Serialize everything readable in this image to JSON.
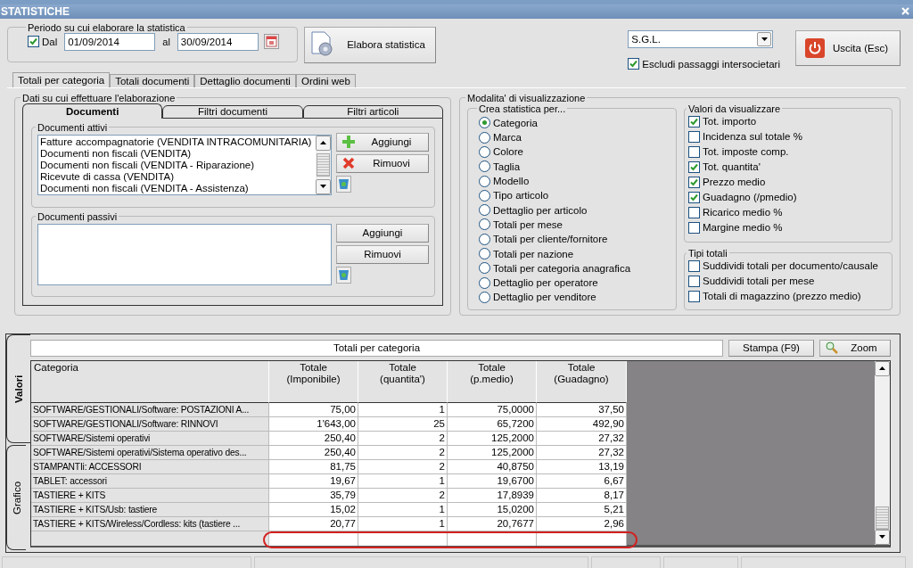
{
  "window": {
    "title": "STATISTICHE"
  },
  "period": {
    "legend": "Periodo su cui elaborare la statistica",
    "from_check": {
      "label": "Dal",
      "checked": true
    },
    "from": "01/09/2014",
    "to_label": "al",
    "to": "30/09/2014"
  },
  "process_button": "Elabora statistica",
  "company": {
    "value": "S.G.L."
  },
  "exclude": {
    "label": "Escludi passaggi intersocietari",
    "checked": true
  },
  "exit_button": "Uscita (Esc)",
  "tabs": [
    {
      "label": "Totali per categoria",
      "selected": true
    },
    {
      "label": "Totali documenti",
      "selected": false
    },
    {
      "label": "Dettaglio documenti",
      "selected": false
    },
    {
      "label": "Ordini web",
      "selected": false
    }
  ],
  "data_group": {
    "legend": "Dati su cui effettuare l'elaborazione",
    "tabs": [
      {
        "label": "Documenti",
        "selected": true
      },
      {
        "label": "Filtri documenti",
        "selected": false
      },
      {
        "label": "Filtri articoli",
        "selected": false
      }
    ],
    "active_docs": {
      "legend": "Documenti attivi",
      "items": [
        "Fatture accompagnatorie (VENDITA INTRACOMUNITARIA)",
        "Documenti non fiscali (VENDITA)",
        "Documenti non fiscali (VENDITA - Riparazione)",
        "Ricevute di cassa (VENDITA)",
        "Documenti non fiscali (VENDITA - Assistenza)"
      ],
      "add": "Aggiungi",
      "remove": "Rimuovi"
    },
    "passive_docs": {
      "legend": "Documenti passivi",
      "add": "Aggiungi",
      "remove": "Rimuovi"
    }
  },
  "view_group": {
    "legend": "Modalita' di visualizzazione",
    "create_by": {
      "legend": "Crea statistica per...",
      "options": [
        {
          "label": "Categoria",
          "selected": true
        },
        {
          "label": "Marca",
          "selected": false
        },
        {
          "label": "Colore",
          "selected": false
        },
        {
          "label": "Taglia",
          "selected": false
        },
        {
          "label": "Modello",
          "selected": false
        },
        {
          "label": "Tipo articolo",
          "selected": false
        },
        {
          "label": "Dettaglio per articolo",
          "selected": false
        },
        {
          "label": "Totali per mese",
          "selected": false
        },
        {
          "label": "Totali per cliente/fornitore",
          "selected": false
        },
        {
          "label": "Totali per nazione",
          "selected": false
        },
        {
          "label": "Totali per categoria anagrafica",
          "selected": false
        },
        {
          "label": "Dettaglio per operatore",
          "selected": false
        },
        {
          "label": "Dettaglio per venditore",
          "selected": false
        }
      ]
    },
    "values": {
      "legend": "Valori da visualizzare",
      "items": [
        {
          "label": "Tot. importo",
          "checked": true
        },
        {
          "label": "Incidenza sul totale %",
          "checked": false
        },
        {
          "label": "Tot. imposte comp.",
          "checked": false
        },
        {
          "label": "Tot. quantita'",
          "checked": true
        },
        {
          "label": "Prezzo medio",
          "checked": true
        },
        {
          "label": "Guadagno (/pmedio)",
          "checked": true
        },
        {
          "label": "Ricarico medio %",
          "checked": false
        },
        {
          "label": "Margine medio %",
          "checked": false
        }
      ]
    },
    "totals_types": {
      "legend": "Tipi totali",
      "items": [
        {
          "label": "Suddividi totali per documento/causale",
          "checked": false
        },
        {
          "label": "Suddividi totali per mese",
          "checked": false
        },
        {
          "label": "Totali di magazzino (prezzo medio)",
          "checked": false
        }
      ]
    }
  },
  "results": {
    "side_tabs": [
      {
        "label": "Valori",
        "selected": true
      },
      {
        "label": "Grafico",
        "selected": false
      }
    ],
    "title": "Totali per categoria",
    "print_button": "Stampa (F9)",
    "zoom_button": "Zoom",
    "table": {
      "columns": [
        "Categoria",
        "Totale\n(Imponibile)",
        "Totale\n(quantita')",
        "Totale\n(p.medio)",
        "Totale\n(Guadagno)"
      ],
      "rows": [
        [
          "SOFTWARE/GESTIONALI/Software: POSTAZIONI A...",
          "75,00",
          "1",
          "75,0000",
          "37,50"
        ],
        [
          "SOFTWARE/GESTIONALI/Software: RINNOVI",
          "1'643,00",
          "25",
          "65,7200",
          "492,90"
        ],
        [
          "SOFTWARE/Sistemi operativi",
          "250,40",
          "2",
          "125,2000",
          "27,32"
        ],
        [
          "SOFTWARE/Sistemi operativi/Sistema operativo des...",
          "250,40",
          "2",
          "125,2000",
          "27,32"
        ],
        [
          "STAMPANTIi: ACCESSORI",
          "81,75",
          "2",
          "40,8750",
          "13,19"
        ],
        [
          "TABLET: accessori",
          "19,67",
          "1",
          "19,6700",
          "6,67"
        ],
        [
          "TASTIERE + KITS",
          "35,79",
          "2",
          "17,8939",
          "8,17"
        ],
        [
          "TASTIERE + KITS/Usb: tastiere",
          "15,02",
          "1",
          "15,0200",
          "5,21"
        ],
        [
          "TASTIERE + KITS/Wireless/Cordless: kits (tastiere ...",
          "20,77",
          "1",
          "20,7677",
          "2,96"
        ]
      ]
    }
  }
}
